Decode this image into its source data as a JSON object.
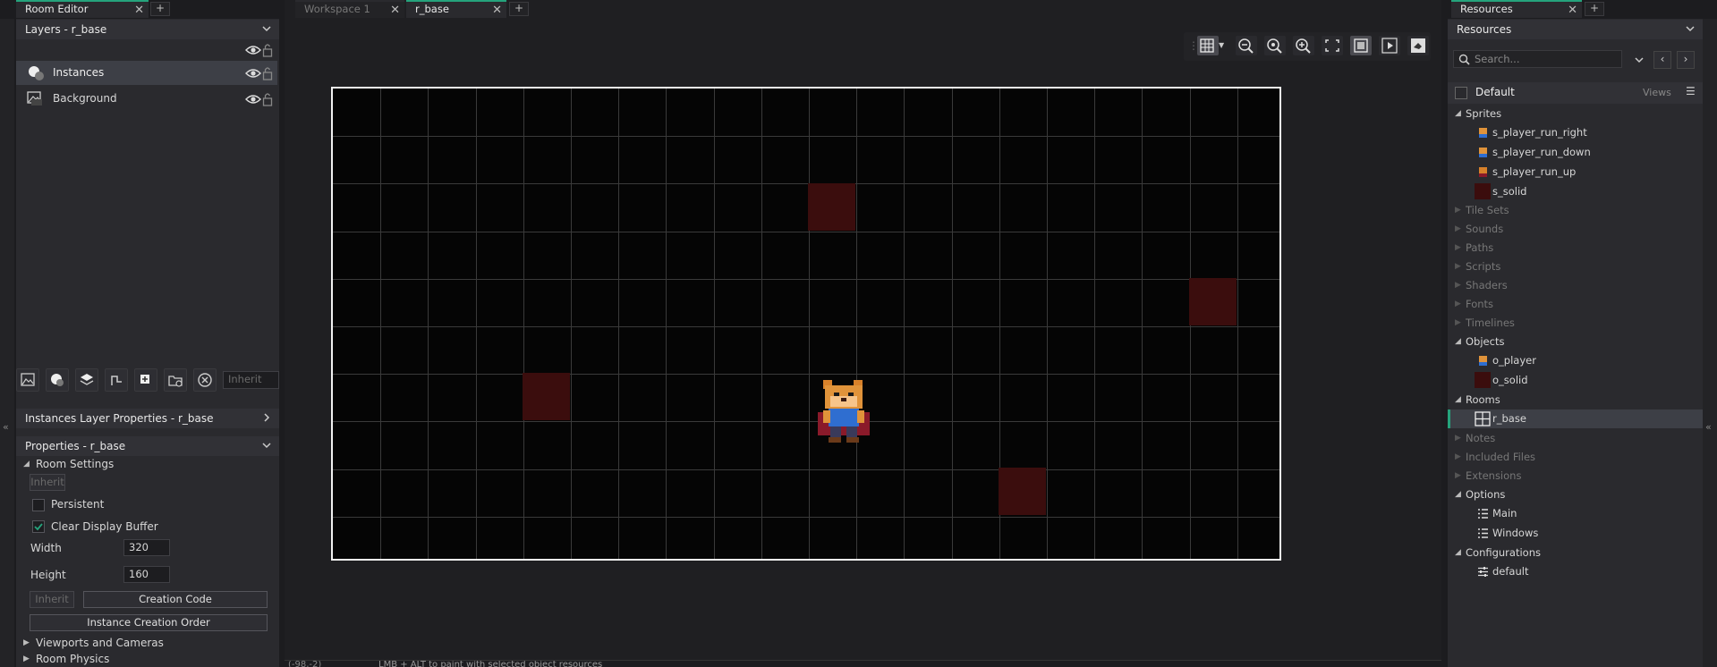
{
  "left_tabs": {
    "active": "Room Editor",
    "add": "+"
  },
  "center_tabs": {
    "inactive": "Workspace 1",
    "active": "r_base",
    "add": "+"
  },
  "right_tabs": {
    "active": "Resources",
    "add": "+"
  },
  "layers": {
    "header": "Layers - r_base",
    "items": [
      {
        "label": "Instances",
        "selected": true
      },
      {
        "label": "Background",
        "selected": false
      }
    ],
    "inherit_placeholder": "Inherit"
  },
  "instances_props_header": "Instances Layer Properties - r_base",
  "properties": {
    "header": "Properties - r_base",
    "room_settings": "Room Settings",
    "inherit": "Inherit",
    "persistent": "Persistent",
    "clear_display_buffer": "Clear Display Buffer",
    "clear_checked": true,
    "width_label": "Width",
    "width_value": "320",
    "height_label": "Height",
    "height_value": "160",
    "inherit2": "Inherit",
    "creation_code": "Creation Code",
    "instance_creation_order": "Instance Creation Order",
    "viewports": "Viewports and Cameras",
    "room_physics": "Room Physics"
  },
  "status": {
    "coords": "(-98,-2)",
    "hint": "LMB + ALT to paint with selected object resources"
  },
  "resources": {
    "header": "Resources",
    "search_placeholder": "Search...",
    "view_name": "Default",
    "views_label": "Views",
    "tree": [
      {
        "label": "Sprites",
        "expanded": true,
        "children": [
          "s_player_run_right",
          "s_player_run_down",
          "s_player_run_up",
          "s_solid"
        ]
      },
      {
        "label": "Tile Sets",
        "expanded": false
      },
      {
        "label": "Sounds",
        "expanded": false
      },
      {
        "label": "Paths",
        "expanded": false
      },
      {
        "label": "Scripts",
        "expanded": false
      },
      {
        "label": "Shaders",
        "expanded": false
      },
      {
        "label": "Fonts",
        "expanded": false
      },
      {
        "label": "Timelines",
        "expanded": false
      },
      {
        "label": "Objects",
        "expanded": true,
        "children": [
          "o_player",
          "o_solid"
        ]
      },
      {
        "label": "Rooms",
        "expanded": true,
        "children": [
          "r_base"
        ]
      },
      {
        "label": "Notes",
        "expanded": false
      },
      {
        "label": "Included Files",
        "expanded": false
      },
      {
        "label": "Extensions",
        "expanded": false
      },
      {
        "label": "Options",
        "expanded": true,
        "children": [
          "Main",
          "Windows"
        ]
      },
      {
        "label": "Configurations",
        "expanded": true,
        "children": [
          "default"
        ]
      }
    ]
  },
  "colors": {
    "accent": "#25a37c",
    "solid": "#3b0d0d",
    "selection": "#3d3f46"
  }
}
